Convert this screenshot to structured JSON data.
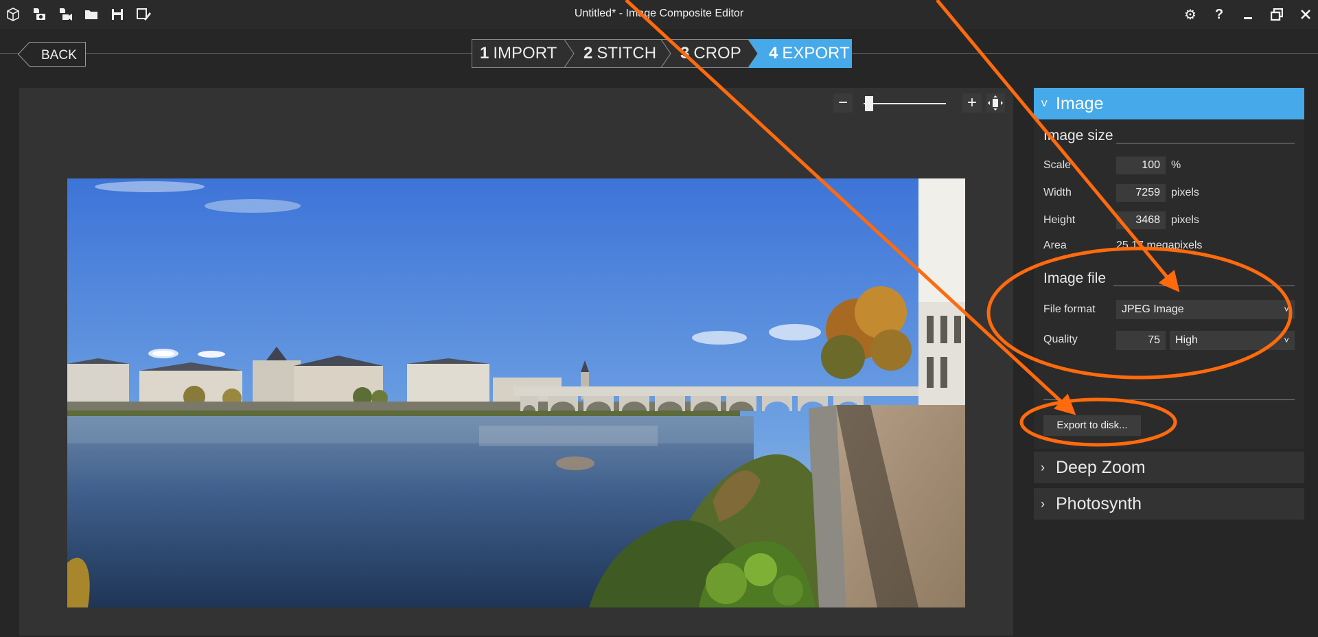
{
  "window": {
    "title": "Untitled* - Image Composite Editor",
    "toolbar_icons": [
      "cube-icon",
      "camera-file-icon",
      "video-file-icon",
      "folder-icon",
      "save-icon",
      "save-as-icon"
    ],
    "window_buttons": [
      "settings-icon",
      "help-icon",
      "minimize-icon",
      "restore-icon",
      "close-icon"
    ]
  },
  "nav": {
    "back_label": "BACK",
    "steps": [
      {
        "num": "1",
        "label": "IMPORT",
        "active": false
      },
      {
        "num": "2",
        "label": "STITCH",
        "active": false
      },
      {
        "num": "3",
        "label": "CROP",
        "active": false
      },
      {
        "num": "4",
        "label": "EXPORT",
        "active": true
      }
    ]
  },
  "zoom": {
    "minus": "−",
    "plus": "+",
    "level": 0.05
  },
  "panel": {
    "image_section": {
      "title": "Image",
      "image_size": {
        "title": "Image size",
        "scale_label": "Scale",
        "scale_value": "100",
        "scale_unit": "%",
        "width_label": "Width",
        "width_value": "7259",
        "width_unit": "pixels",
        "height_label": "Height",
        "height_value": "3468",
        "height_unit": "pixels",
        "area_label": "Area",
        "area_value": "25,17 megapixels"
      },
      "image_file": {
        "title": "Image file",
        "format_label": "File format",
        "format_value": "JPEG Image",
        "quality_label": "Quality",
        "quality_value": "75",
        "quality_preset": "High"
      },
      "export_button": "Export to disk..."
    },
    "deep_zoom_title": "Deep Zoom",
    "photosynth_title": "Photosynth"
  },
  "colors": {
    "accent": "#45a9ea",
    "annotation": "#ff6a0d",
    "background": "#262626"
  }
}
